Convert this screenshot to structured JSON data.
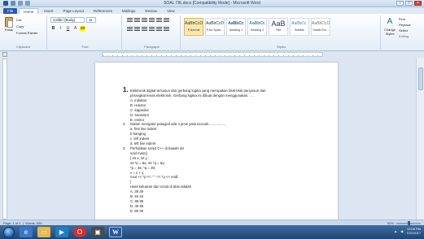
{
  "window": {
    "title": "SOAL TIK.docx [Compatibility Mode] - Microsoft Word"
  },
  "tabs": [
    "File",
    "Home",
    "Insert",
    "Page Layout",
    "References",
    "Mailings",
    "Review",
    "View"
  ],
  "clipboard": {
    "paste": "Paste",
    "cut": "Cut",
    "copy": "Copy",
    "painter": "Format Painter",
    "label": "Clipboard"
  },
  "font": {
    "name": "Calibri (Body)",
    "size": "11",
    "label": "Font",
    "bold": "B",
    "italic": "I",
    "underline": "U"
  },
  "paragraph": {
    "label": "Paragraph"
  },
  "styles": {
    "label": "Styles",
    "items": [
      {
        "sample": "AaBbCcDc",
        "name": "¶ Normal"
      },
      {
        "sample": "AaBbCcDc",
        "name": "¶ No Spaci..."
      },
      {
        "sample": "AaBbCc",
        "name": "Heading 1"
      },
      {
        "sample": "AaBbCc",
        "name": "Heading 2"
      },
      {
        "sample": "AaB",
        "name": "Title"
      },
      {
        "sample": "AaBbCc.",
        "name": "Subtitle"
      },
      {
        "sample": "AaBbCcDc",
        "name": "Subtle Em..."
      }
    ],
    "change": "Change Styles"
  },
  "editing": {
    "find": "Find",
    "replace": "Replace",
    "select": "Select",
    "label": "Editing"
  },
  "document": {
    "lines": [
      {
        "num": "1.",
        "text": "Elektronik digital tersusun dari gerbang logika yang merupakan blok-blok penyusun dari",
        "big": true
      },
      {
        "text": "perangkat keras elektronik. Gerbang logika ini dibuat dengan menggunakan. . . .",
        "ind": true
      },
      {
        "text": "A. induktor",
        "ind": true
      },
      {
        "text": "B. resistor",
        "ind": true
      },
      {
        "text": "C. kapasitor",
        "ind": true
      },
      {
        "text": "D. transistor",
        "ind": true
      },
      {
        "text": "E. emitor",
        "ind": true
      },
      {
        "num": "2.",
        "text": "Dalam mengatur paragraf ada 4 jenis yaitu kecuali.................."
      },
      {
        "text": "a. first line indent",
        "ind": true
      },
      {
        "text": "b.hanging",
        "ind": true
      },
      {
        "text": "c. left indent",
        "ind": true
      },
      {
        "text": "d. left line indent",
        "ind": true
      },
      {
        "num": "3.",
        "text": "Perhatikan script C++ di bawah ini!"
      },
      {
        "text": "void main()",
        "ind": true
      },
      {
        "text": "{ int x, int y ;",
        "ind": true
      },
      {
        "text": "    int *p = &x, int *q = &y;",
        "ind": true
      },
      {
        "text": "        *p = 46, *q = 39;",
        "ind": true
      },
      {
        "text": "    x = x + y;",
        "ind": true
      },
      {
        "text": "    cout << *p << \" \" << *q << endl;",
        "ind": true
      },
      {
        "text": "}",
        "ind": true
      },
      {
        "text": "Hasil keluaran dari script di atas adalah",
        "ind": true
      },
      {
        "text": "A. 39 39",
        "ind": true
      },
      {
        "text": "B. 46 46",
        "ind": true
      },
      {
        "text": "C. 85 85",
        "ind": true
      },
      {
        "text": "D. 46 85",
        "ind": true
      },
      {
        "text": "E. 85 39",
        "ind": true
      }
    ]
  },
  "status": {
    "page": "Page: 1 of 1",
    "words": "Words: 449",
    "zoom": "90%"
  },
  "tray": {
    "time": "12:08 PM",
    "date": "7/21/2017"
  },
  "colors": {
    "accent": "#2b579a",
    "ribbon": "#dfe9f5"
  }
}
